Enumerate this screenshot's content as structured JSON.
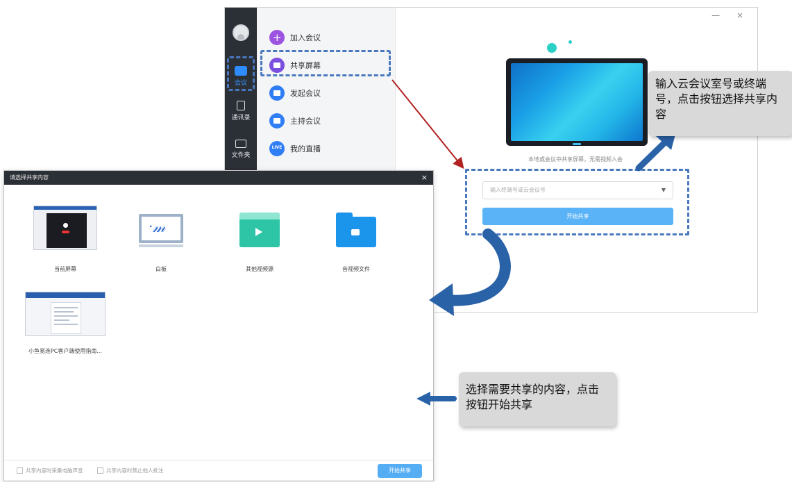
{
  "main_window": {
    "controls": "—  ×",
    "sidebar": {
      "items": [
        {
          "label": "会议"
        },
        {
          "label": "通讯录"
        },
        {
          "label": "文件夹"
        }
      ]
    },
    "menu": [
      {
        "label": "加入会议"
      },
      {
        "label": "共享屏幕"
      },
      {
        "label": "发起会议"
      },
      {
        "label": "主持会议"
      },
      {
        "label": "我的直播"
      }
    ],
    "live_icon_text": "LIVE",
    "hint": "本地或会议中共享屏幕，无需视频入会",
    "number_placeholder": "输入终端号或云会议号",
    "start_share": "开始共享"
  },
  "dialog": {
    "title": "请选择共享内容",
    "close": "×",
    "sources": [
      {
        "label": "当前屏幕"
      },
      {
        "label": "白板"
      },
      {
        "label": "其他视频源"
      },
      {
        "label": "音视频文件"
      },
      {
        "label": "小鱼易连PC客户端使用指南..."
      }
    ],
    "footer": {
      "option1": "共享内容时采集电脑声音",
      "option2": "共享内容时禁止他人批注",
      "start_share": "开始共享"
    }
  },
  "callouts": {
    "top": "输入云会议室号或终端号，点击按钮选择共享内容",
    "bottom": "选择需要共享的内容，点击按钮开始共享"
  }
}
